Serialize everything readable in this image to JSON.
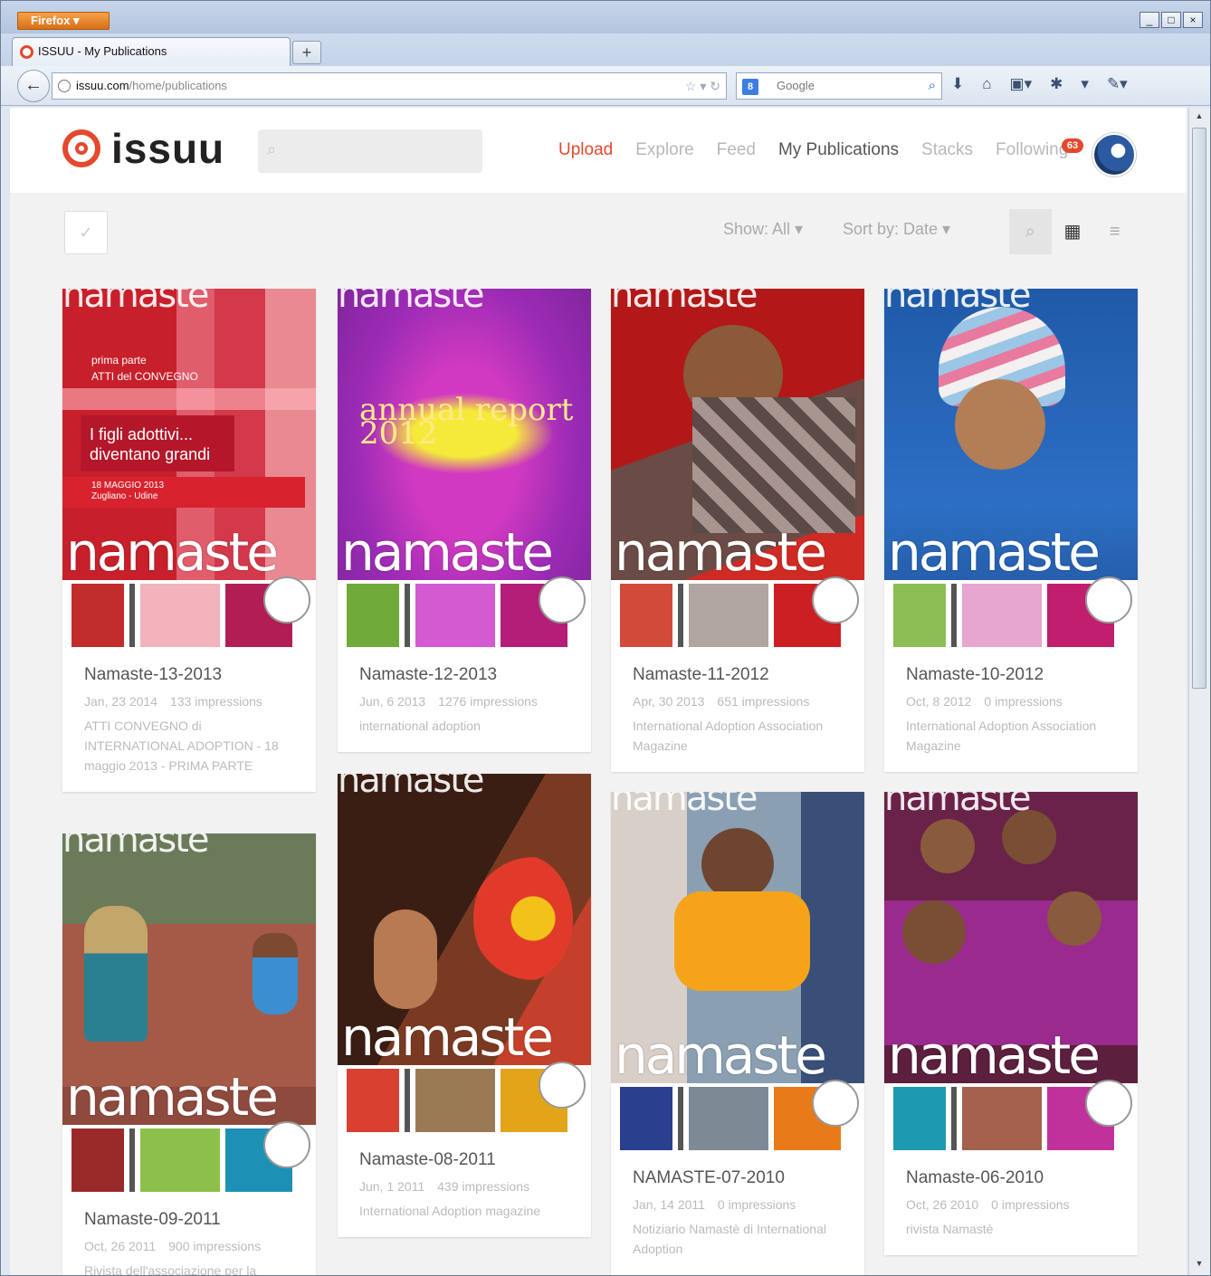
{
  "browser": {
    "app_button": "Firefox",
    "window_controls": [
      "_",
      "□",
      "×"
    ],
    "tab_title": "ISSUU - My Publications",
    "new_tab": "+",
    "url_host": "issuu.com",
    "url_path": "/home/publications",
    "search_engine_badge": "8",
    "search_placeholder": "Google"
  },
  "site": {
    "logo": "issuu",
    "nav": {
      "upload": "Upload",
      "explore": "Explore",
      "feed": "Feed",
      "my_publications": "My Publications",
      "stacks": "Stacks",
      "following": "Following"
    },
    "following_badge": "63"
  },
  "toolbar": {
    "check": "✓",
    "show": "Show: All ▾",
    "sort": "Sort by: Date ▾"
  },
  "colors": {
    "accent": "#e4482d"
  },
  "publications": [
    {
      "title": "Namaste-13-2013",
      "date": "Jan, 23 2014",
      "impressions": "133 impressions",
      "description": "ATTI CONVEGNO di INTERNATIONAL ADOPTION - 18 maggio 2013 - PRIMA PARTE",
      "cover_lines": [
        "prima parte",
        "ATTI del CONVEGNO",
        "I figli adottivi...",
        "diventano grandi",
        "18 MAGGIO 2013",
        "Zugliano - Udine"
      ]
    },
    {
      "title": "Namaste-12-2013",
      "date": "Jun, 6 2013",
      "impressions": "1276 impressions",
      "description": "international adoption",
      "cover_lines": [
        "annual report",
        "2012"
      ]
    },
    {
      "title": "Namaste-11-2012",
      "date": "Apr, 30 2013",
      "impressions": "651 impressions",
      "description": "International Adoption Association Magazine"
    },
    {
      "title": "Namaste-10-2012",
      "date": "Oct, 8 2012",
      "impressions": "0 impressions",
      "description": "International Adoption Association Magazine"
    },
    {
      "title": "Namaste-09-2011",
      "date": "Oct, 26 2011",
      "impressions": "900 impressions",
      "description": "Rivista dell'associazione per la"
    },
    {
      "title": "Namaste-08-2011",
      "date": "Jun, 1 2011",
      "impressions": "439 impressions",
      "description": "International Adoption magazine"
    },
    {
      "title": "NAMASTE-07-2010",
      "date": "Jan, 14 2011",
      "impressions": "0 impressions",
      "description": "Notiziario Namastè di International Adoption"
    },
    {
      "title": "Namaste-06-2010",
      "date": "Oct, 26 2010",
      "impressions": "0 impressions",
      "description": "rivista Namastè"
    }
  ],
  "cover_word": "namaste"
}
